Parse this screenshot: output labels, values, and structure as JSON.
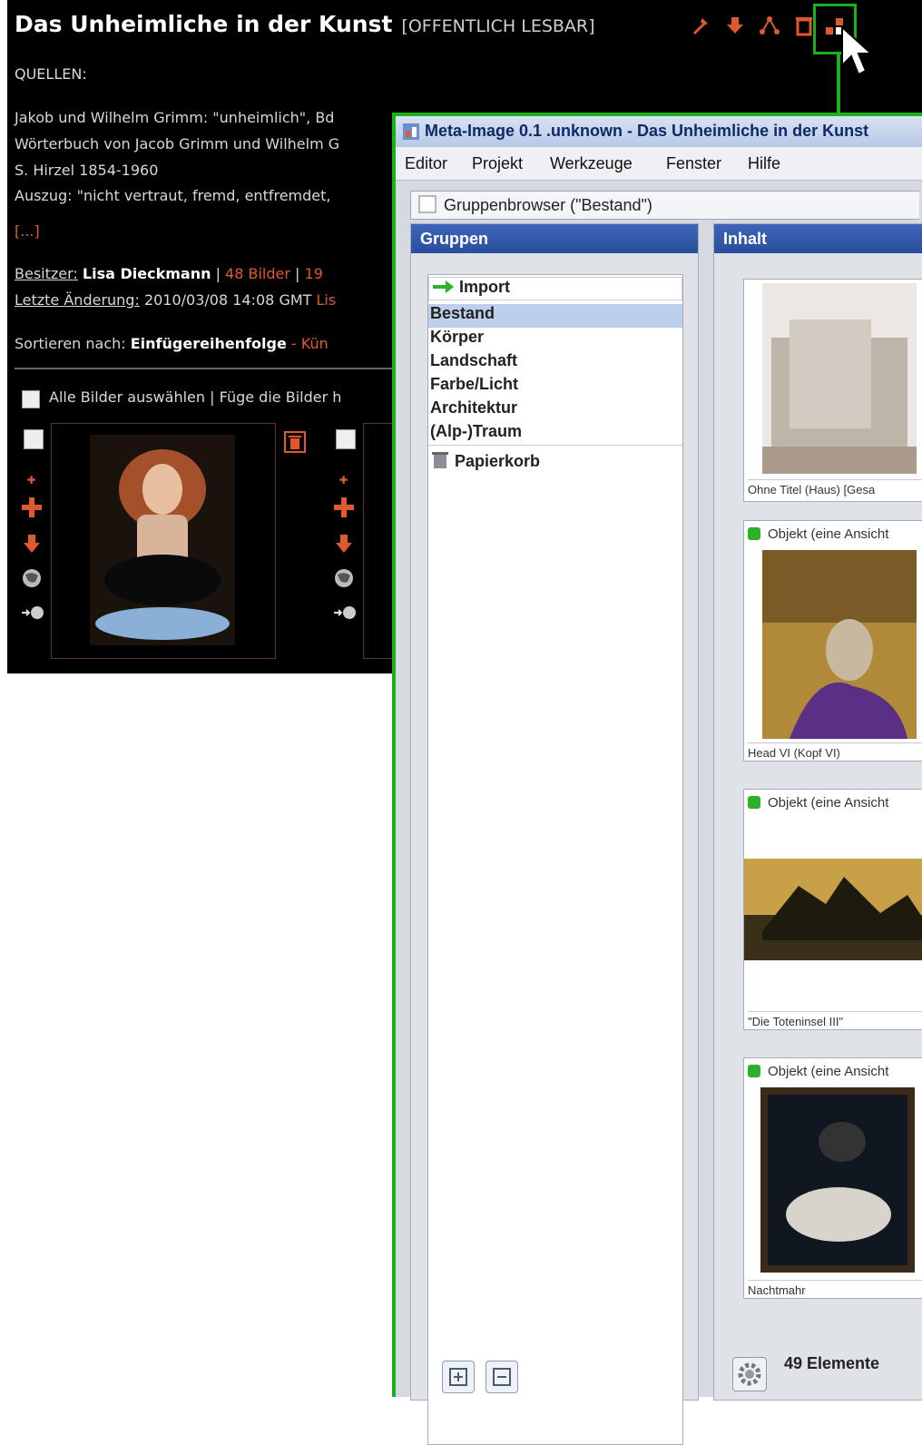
{
  "page": {
    "title": "Das Unheimliche in der Kunst",
    "visibility": "[OFFENTLICH LESBAR]",
    "sources_heading": "QUELLEN:",
    "source_lines": [
      "Jakob und Wilhelm Grimm: \"unheimlich\", Bd",
      "Wörterbuch von Jacob Grimm und Wilhelm G",
      "S. Hirzel 1854-1960",
      "Auszug: \"nicht vertraut, fremd, entfremdet,"
    ],
    "more_link": "[...]",
    "owner_label": "Besitzer:",
    "owner_name": "Lisa Dieckmann",
    "owner_sep": "|",
    "image_count": "48 Bilder",
    "owner_sep2": "|",
    "count2": "19",
    "last_change_label": "Letzte Änderung:",
    "last_change_value": "2010/03/08 14:08 GMT",
    "last_change_user": "Lis",
    "sort_label": "Sortieren nach:",
    "sort_value": "Einfügereihenfolge",
    "sort_sep": "-",
    "sort_next": "Kün",
    "select_all": "Alle Bilder auswählen",
    "select_sep": "|",
    "add_images": "Füge die Bilder h"
  },
  "window": {
    "title": "Meta-Image 0.1 .unknown - Das Unheimliche in der Kunst",
    "menu": [
      "Editor",
      "Projekt",
      "Werkzeuge",
      "Fenster",
      "Hilfe"
    ],
    "frame_title": "Gruppenbrowser (\"Bestand\")",
    "groups_header": "Gruppen",
    "content_header": "Inhalt",
    "groups": [
      {
        "label": "Import"
      },
      {
        "label": "Bestand"
      },
      {
        "label": "Körper"
      },
      {
        "label": "Landschaft"
      },
      {
        "label": "Farbe/Licht"
      },
      {
        "label": "Architektur"
      },
      {
        "label": "(Alp-)Traum"
      },
      {
        "label": "Papierkorb"
      }
    ],
    "selected_group": "Bestand",
    "cards": [
      {
        "header": "",
        "caption": "Ohne Titel (Haus) [Gesa"
      },
      {
        "header": "Objekt (eine Ansicht",
        "caption": "Head VI (Kopf VI)"
      },
      {
        "header": "Objekt (eine Ansicht",
        "caption": "\"Die Toteninsel III\""
      },
      {
        "header": "Objekt (eine Ansicht",
        "caption": "Nachtmahr"
      }
    ],
    "status": "49 Elemente"
  },
  "colors": {
    "accent_red": "#e0582e",
    "highlight_green": "#1bb11b",
    "panel_blue": "#2a4f9d"
  }
}
